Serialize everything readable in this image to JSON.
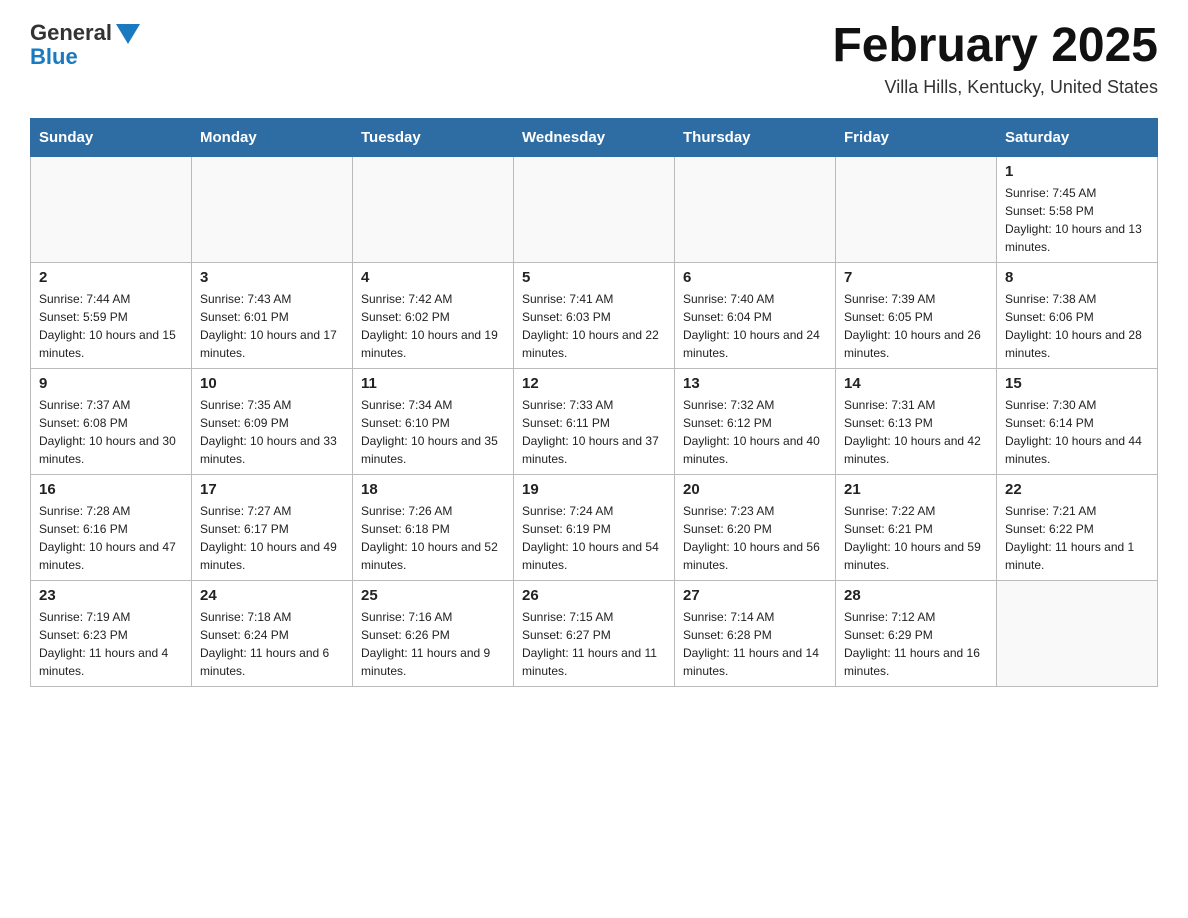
{
  "header": {
    "logo_general": "General",
    "logo_blue": "Blue",
    "month_title": "February 2025",
    "location": "Villa Hills, Kentucky, United States"
  },
  "days_of_week": [
    "Sunday",
    "Monday",
    "Tuesday",
    "Wednesday",
    "Thursday",
    "Friday",
    "Saturday"
  ],
  "weeks": [
    [
      {
        "num": "",
        "info": ""
      },
      {
        "num": "",
        "info": ""
      },
      {
        "num": "",
        "info": ""
      },
      {
        "num": "",
        "info": ""
      },
      {
        "num": "",
        "info": ""
      },
      {
        "num": "",
        "info": ""
      },
      {
        "num": "1",
        "info": "Sunrise: 7:45 AM\nSunset: 5:58 PM\nDaylight: 10 hours and 13 minutes."
      }
    ],
    [
      {
        "num": "2",
        "info": "Sunrise: 7:44 AM\nSunset: 5:59 PM\nDaylight: 10 hours and 15 minutes."
      },
      {
        "num": "3",
        "info": "Sunrise: 7:43 AM\nSunset: 6:01 PM\nDaylight: 10 hours and 17 minutes."
      },
      {
        "num": "4",
        "info": "Sunrise: 7:42 AM\nSunset: 6:02 PM\nDaylight: 10 hours and 19 minutes."
      },
      {
        "num": "5",
        "info": "Sunrise: 7:41 AM\nSunset: 6:03 PM\nDaylight: 10 hours and 22 minutes."
      },
      {
        "num": "6",
        "info": "Sunrise: 7:40 AM\nSunset: 6:04 PM\nDaylight: 10 hours and 24 minutes."
      },
      {
        "num": "7",
        "info": "Sunrise: 7:39 AM\nSunset: 6:05 PM\nDaylight: 10 hours and 26 minutes."
      },
      {
        "num": "8",
        "info": "Sunrise: 7:38 AM\nSunset: 6:06 PM\nDaylight: 10 hours and 28 minutes."
      }
    ],
    [
      {
        "num": "9",
        "info": "Sunrise: 7:37 AM\nSunset: 6:08 PM\nDaylight: 10 hours and 30 minutes."
      },
      {
        "num": "10",
        "info": "Sunrise: 7:35 AM\nSunset: 6:09 PM\nDaylight: 10 hours and 33 minutes."
      },
      {
        "num": "11",
        "info": "Sunrise: 7:34 AM\nSunset: 6:10 PM\nDaylight: 10 hours and 35 minutes."
      },
      {
        "num": "12",
        "info": "Sunrise: 7:33 AM\nSunset: 6:11 PM\nDaylight: 10 hours and 37 minutes."
      },
      {
        "num": "13",
        "info": "Sunrise: 7:32 AM\nSunset: 6:12 PM\nDaylight: 10 hours and 40 minutes."
      },
      {
        "num": "14",
        "info": "Sunrise: 7:31 AM\nSunset: 6:13 PM\nDaylight: 10 hours and 42 minutes."
      },
      {
        "num": "15",
        "info": "Sunrise: 7:30 AM\nSunset: 6:14 PM\nDaylight: 10 hours and 44 minutes."
      }
    ],
    [
      {
        "num": "16",
        "info": "Sunrise: 7:28 AM\nSunset: 6:16 PM\nDaylight: 10 hours and 47 minutes."
      },
      {
        "num": "17",
        "info": "Sunrise: 7:27 AM\nSunset: 6:17 PM\nDaylight: 10 hours and 49 minutes."
      },
      {
        "num": "18",
        "info": "Sunrise: 7:26 AM\nSunset: 6:18 PM\nDaylight: 10 hours and 52 minutes."
      },
      {
        "num": "19",
        "info": "Sunrise: 7:24 AM\nSunset: 6:19 PM\nDaylight: 10 hours and 54 minutes."
      },
      {
        "num": "20",
        "info": "Sunrise: 7:23 AM\nSunset: 6:20 PM\nDaylight: 10 hours and 56 minutes."
      },
      {
        "num": "21",
        "info": "Sunrise: 7:22 AM\nSunset: 6:21 PM\nDaylight: 10 hours and 59 minutes."
      },
      {
        "num": "22",
        "info": "Sunrise: 7:21 AM\nSunset: 6:22 PM\nDaylight: 11 hours and 1 minute."
      }
    ],
    [
      {
        "num": "23",
        "info": "Sunrise: 7:19 AM\nSunset: 6:23 PM\nDaylight: 11 hours and 4 minutes."
      },
      {
        "num": "24",
        "info": "Sunrise: 7:18 AM\nSunset: 6:24 PM\nDaylight: 11 hours and 6 minutes."
      },
      {
        "num": "25",
        "info": "Sunrise: 7:16 AM\nSunset: 6:26 PM\nDaylight: 11 hours and 9 minutes."
      },
      {
        "num": "26",
        "info": "Sunrise: 7:15 AM\nSunset: 6:27 PM\nDaylight: 11 hours and 11 minutes."
      },
      {
        "num": "27",
        "info": "Sunrise: 7:14 AM\nSunset: 6:28 PM\nDaylight: 11 hours and 14 minutes."
      },
      {
        "num": "28",
        "info": "Sunrise: 7:12 AM\nSunset: 6:29 PM\nDaylight: 11 hours and 16 minutes."
      },
      {
        "num": "",
        "info": ""
      }
    ]
  ]
}
